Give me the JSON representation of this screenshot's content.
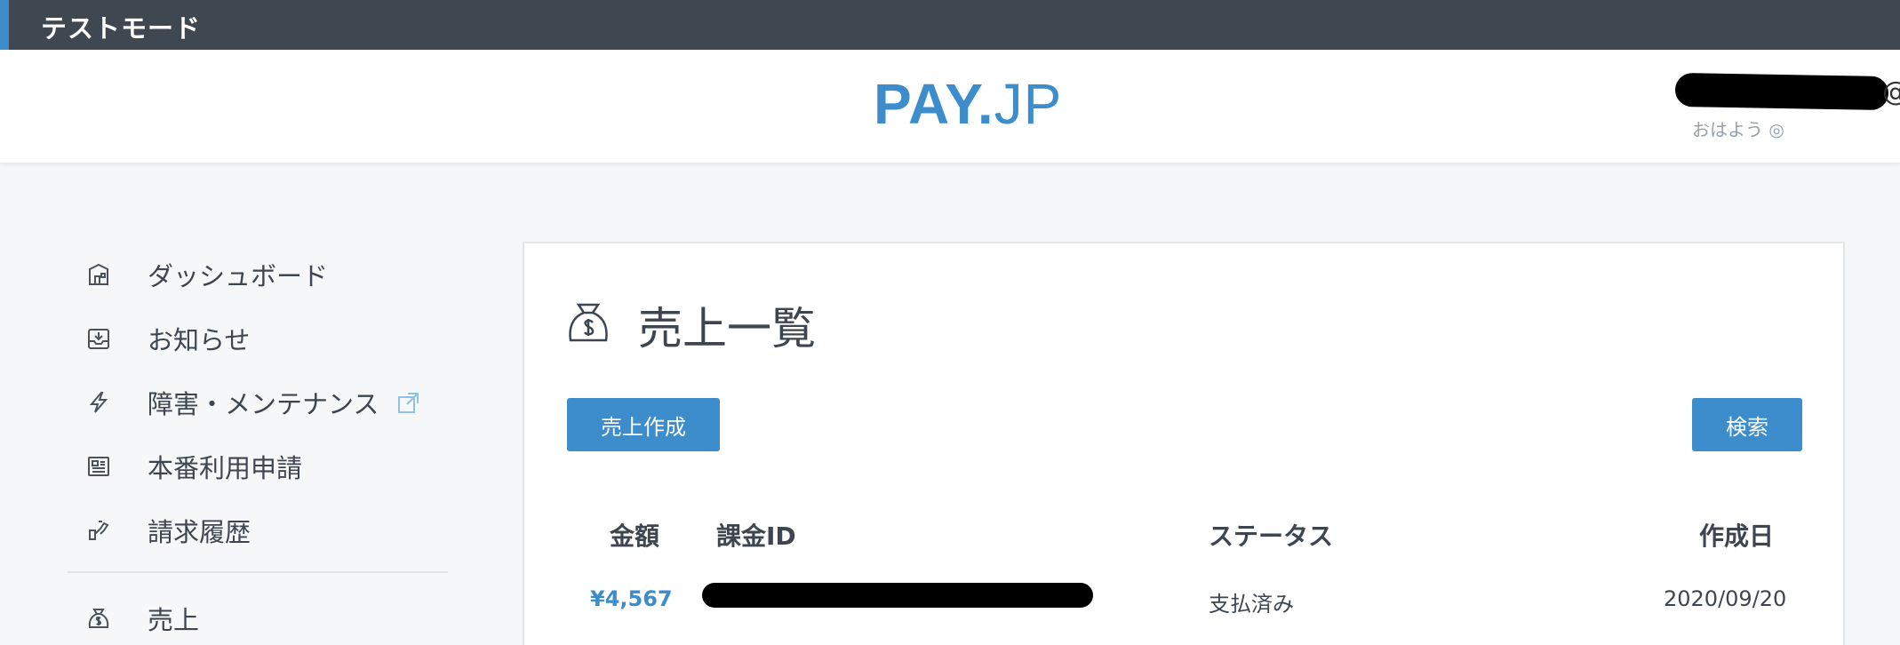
{
  "test_mode": {
    "label": "テストモード"
  },
  "header": {
    "logo": {
      "pay": "PAY",
      "dot": ".",
      "jp": "JP"
    },
    "user": {
      "at_symbol": "@",
      "greeting": "おはよう ◎"
    }
  },
  "sidebar": {
    "items": [
      {
        "label": "ダッシュボード",
        "icon": "store-icon"
      },
      {
        "label": "お知らせ",
        "icon": "inbox-icon"
      },
      {
        "label": "障害・メンテナンス",
        "icon": "lightning-icon",
        "external": true
      },
      {
        "label": "本番利用申請",
        "icon": "newspaper-icon"
      },
      {
        "label": "請求履歴",
        "icon": "history-icon"
      },
      {
        "label": "売上",
        "icon": "money-bag-icon"
      }
    ]
  },
  "main": {
    "title": "売上一覧",
    "create_button": "売上作成",
    "search_button": "検索",
    "table": {
      "headers": {
        "amount": "金額",
        "charge_id": "課金ID",
        "status": "ステータス",
        "created": "作成日"
      },
      "rows": [
        {
          "amount": "¥4,567",
          "status": "支払済み",
          "created": "2020/09/20"
        }
      ]
    }
  },
  "colors": {
    "accent": "#3d8dcc",
    "topbar": "#3f4751",
    "background": "#f5f7f8"
  }
}
